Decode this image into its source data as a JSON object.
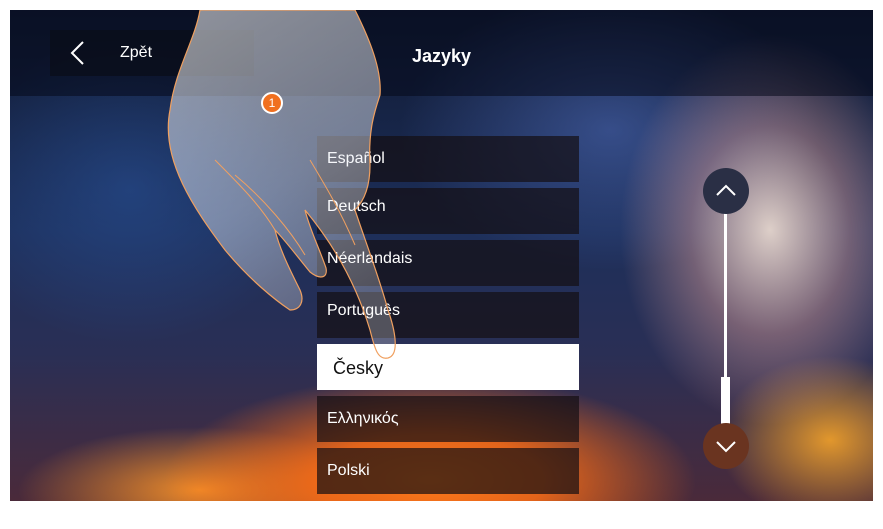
{
  "header": {
    "back_label": "Zpět",
    "title": "Jazyky"
  },
  "languages": [
    {
      "label": "Español",
      "selected": false
    },
    {
      "label": "Deutsch",
      "selected": false
    },
    {
      "label": "Néerlandais",
      "selected": false
    },
    {
      "label": "Português",
      "selected": false
    },
    {
      "label": "Česky",
      "selected": true
    },
    {
      "label": "Ελληνικός",
      "selected": false
    },
    {
      "label": "Polski",
      "selected": false
    }
  ],
  "annotation": {
    "step_number": "1"
  },
  "icons": {
    "back": "chevron-left-icon",
    "scroll_up": "chevron-up-icon",
    "scroll_down": "chevron-down-icon",
    "pointer": "hand-pointer-icon"
  },
  "colors": {
    "accent": "#f07020",
    "selected_bg": "#ffffff",
    "item_bg": "#140e12"
  }
}
